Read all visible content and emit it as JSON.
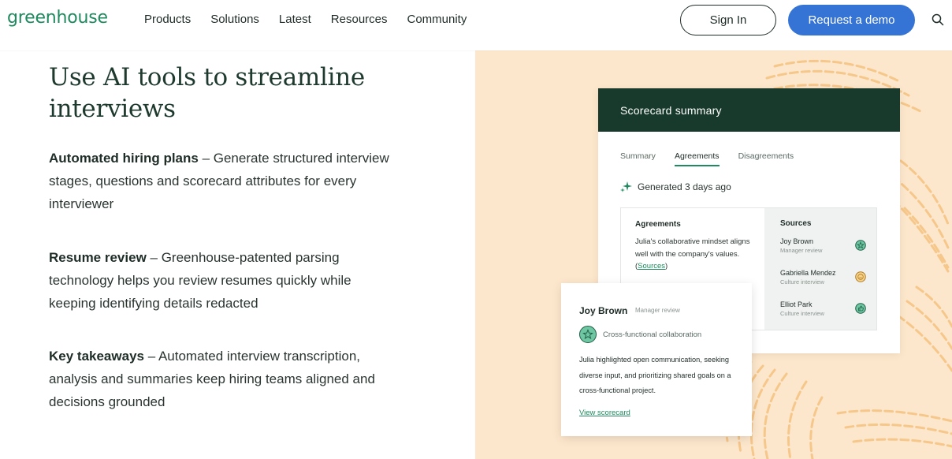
{
  "nav": {
    "logo": "greenhouse",
    "items": [
      {
        "label": "Products"
      },
      {
        "label": "Solutions"
      },
      {
        "label": "Latest"
      },
      {
        "label": "Resources"
      },
      {
        "label": "Community"
      }
    ],
    "signin_label": "Sign In",
    "demo_label": "Request a demo",
    "search_icon": "search-icon"
  },
  "main": {
    "headline": "Use AI tools to streamline interviews",
    "features": [
      {
        "title": "Automated hiring plans",
        "text": " – Generate structured interview stages, questions and scorecard attributes for every interviewer"
      },
      {
        "title": "Resume review",
        "text": " – Greenhouse-patented parsing technology helps you review resumes quickly while keeping identifying details redacted"
      },
      {
        "title": "Key takeaways",
        "text": " – Automated interview transcription, analysis and summaries keep hiring teams aligned and decisions grounded"
      }
    ]
  },
  "scorecard": {
    "title": "Scorecard summary",
    "tabs": [
      {
        "label": "Summary",
        "active": false
      },
      {
        "label": "Agreements",
        "active": true
      },
      {
        "label": "Disagreements",
        "active": false
      }
    ],
    "generated": "Generated 3 days ago",
    "agreements_title": "Agreements",
    "agreements_text": "Julia's collaborative mindset aligns well with the company's values. (",
    "agreements_link": "Sources",
    "agreements_close": ")",
    "sources_title": "Sources",
    "sources": [
      {
        "name": "Joy Brown",
        "role": "Manager review",
        "icon": "star-icon"
      },
      {
        "name": "Gabriella Mendez",
        "role": "Culture interview",
        "icon": "neutral-face-icon"
      },
      {
        "name": "Elliot Park",
        "role": "Culture interview",
        "icon": "thumbs-up-icon"
      }
    ]
  },
  "popup": {
    "name": "Joy Brown",
    "role": "Manager review",
    "attribute": "Cross-functional collaboration",
    "body": "Julia highlighted open communication, seeking diverse input, and prioritizing shared goals on a cross-functional project.",
    "link": "View scorecard"
  },
  "colors": {
    "brand_green": "#1e8a5e",
    "demo_blue": "#3574d4",
    "card_header": "#183a2c",
    "art_bg": "#fde7cc",
    "fingerprint": "#f6c78a"
  }
}
